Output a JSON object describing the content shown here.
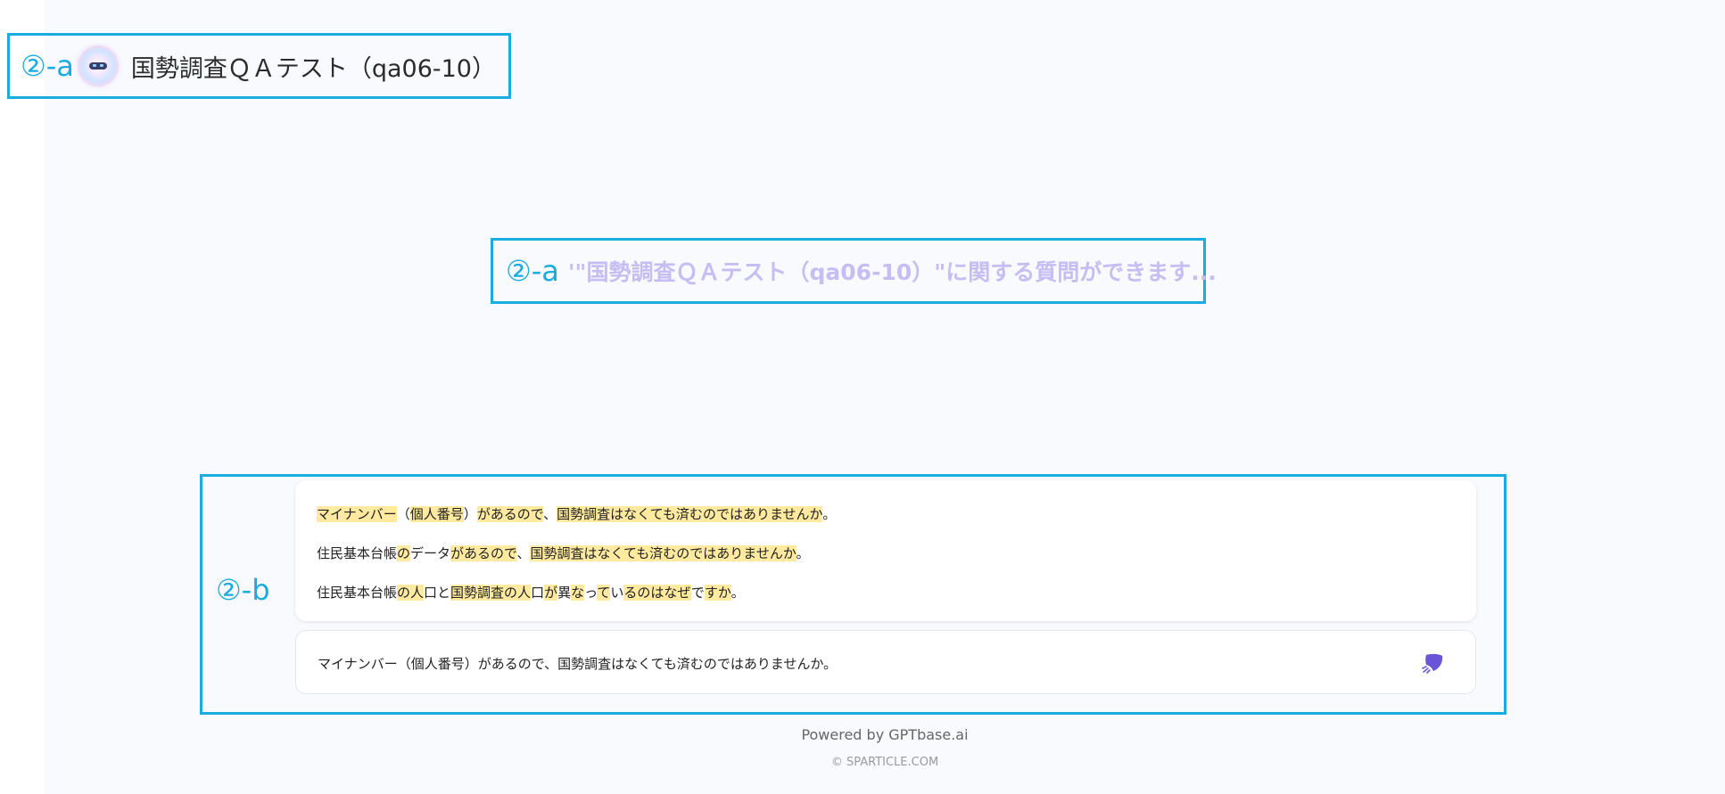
{
  "header": {
    "annotation": "②-a",
    "bot_title": "国勢調査ＱＡテスト（qa06-10）"
  },
  "hint": {
    "annotation": "②-a",
    "text": "'\"国勢調査ＱＡテスト（qa06-10）\"に関する質問ができます..."
  },
  "chat": {
    "annotation": "②-b",
    "suggestions": [
      [
        {
          "t": "マイナンバー",
          "h": true
        },
        {
          "t": "（",
          "h": false
        },
        {
          "t": "個人番号",
          "h": true
        },
        {
          "t": "）",
          "h": false
        },
        {
          "t": "があるので",
          "h": true
        },
        {
          "t": "、",
          "h": false
        },
        {
          "t": "国勢調査はなくても済むのではありませんか",
          "h": true
        },
        {
          "t": "。",
          "h": false
        }
      ],
      [
        {
          "t": "住民基本台帳",
          "h": false
        },
        {
          "t": "の",
          "h": true
        },
        {
          "t": "データ",
          "h": false
        },
        {
          "t": "があるので",
          "h": true
        },
        {
          "t": "、",
          "h": false
        },
        {
          "t": "国勢調査はなくても済むのではありませんか",
          "h": true
        },
        {
          "t": "。",
          "h": false
        }
      ],
      [
        {
          "t": "住民基本台帳",
          "h": false
        },
        {
          "t": "の人",
          "h": true
        },
        {
          "t": "口と",
          "h": false
        },
        {
          "t": "国勢調査の人",
          "h": true
        },
        {
          "t": "口",
          "h": false
        },
        {
          "t": "が",
          "h": true
        },
        {
          "t": "異",
          "h": false
        },
        {
          "t": "な",
          "h": true
        },
        {
          "t": "っ",
          "h": false
        },
        {
          "t": "て",
          "h": true
        },
        {
          "t": "い",
          "h": false
        },
        {
          "t": "るのはなぜ",
          "h": true
        },
        {
          "t": "で",
          "h": false
        },
        {
          "t": "すか",
          "h": true
        },
        {
          "t": "。",
          "h": false
        }
      ]
    ],
    "input_value": "マイナンバー（個人番号）があるので、国勢調査はなくても済むのではありませんか。",
    "send_icon": "send-icon"
  },
  "footer": {
    "powered": "Powered by GPTbase.ai",
    "copyright": "© SPARTICLE.COM"
  },
  "colors": {
    "annotation": "#1aabdf",
    "highlight": "#ffeaa0",
    "hint": "#c6bdf3",
    "send": "#6a55d8"
  }
}
